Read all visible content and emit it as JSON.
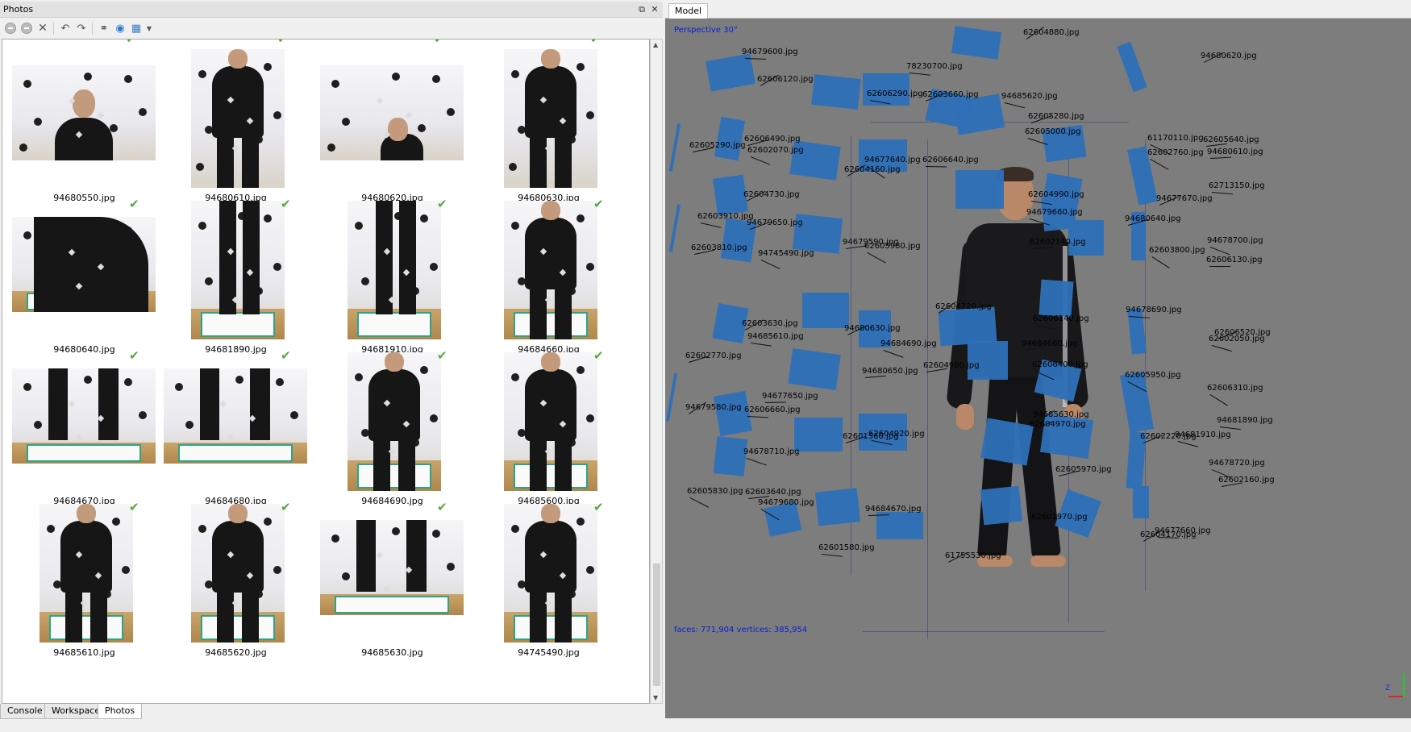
{
  "photos_panel": {
    "title": "Photos",
    "photos": [
      {
        "name": "94680550.jpg",
        "checked": false
      },
      {
        "name": "94680610.jpg",
        "checked": false
      },
      {
        "name": "94680620.jpg",
        "checked": false
      },
      {
        "name": "94680630.jpg",
        "checked": false
      },
      {
        "name": "94680640.jpg",
        "checked": true
      },
      {
        "name": "94681890.jpg",
        "checked": true
      },
      {
        "name": "94681910.jpg",
        "checked": true
      },
      {
        "name": "94684660.jpg",
        "checked": true
      },
      {
        "name": "94684670.jpg",
        "checked": true
      },
      {
        "name": "94684680.jpg",
        "checked": true
      },
      {
        "name": "94684690.jpg",
        "checked": true
      },
      {
        "name": "94685600.jpg",
        "checked": true
      },
      {
        "name": "94685610.jpg",
        "checked": true
      },
      {
        "name": "94685620.jpg",
        "checked": true
      },
      {
        "name": "94685630.jpg",
        "checked": true
      },
      {
        "name": "94745490.jpg",
        "checked": true
      }
    ],
    "check_glyph": "✔"
  },
  "bottom_tabs": {
    "console": "Console",
    "workspace": "Workspace",
    "photos": "Photos",
    "active": "Photos"
  },
  "model_panel": {
    "tab": "Model",
    "projection": "Perspective 30°",
    "stats": "faces: 771,904 vertices: 385,954",
    "axis_label": "Z",
    "camera_labels": [
      "62604880.jpg",
      "94679600.jpg",
      "62606120.jpg",
      "78230700.jpg",
      "94680620.jpg",
      "62606290.jpg",
      "62603660.jpg",
      "94685620.jpg",
      "62605280.jpg",
      "62605000.jpg",
      "62606490.jpg",
      "62602070.jpg",
      "62605290.jpg",
      "61170110.jpg",
      "62605640.jpg",
      "62602760.jpg",
      "94680610.jpg",
      "94677640.jpg",
      "62606640.jpg",
      "62604160.jpg",
      "62713150.jpg",
      "62604730.jpg",
      "62604990.jpg",
      "94677670.jpg",
      "62603910.jpg",
      "94679650.jpg",
      "94679660.jpg",
      "94680640.jpg",
      "94678700.jpg",
      "62603810.jpg",
      "94745490.jpg",
      "94679590.jpg",
      "62605980.jpg",
      "62602140.jpg",
      "62603800.jpg",
      "62606130.jpg",
      "62604720.jpg",
      "94678690.jpg",
      "62603630.jpg",
      "94685610.jpg",
      "94680630.jpg",
      "62606140.jpg",
      "62606520.jpg",
      "62602050.jpg",
      "62602770.jpg",
      "94684690.jpg",
      "94684660.jpg",
      "62606400.jpg",
      "62604980.jpg",
      "62605950.jpg",
      "94680650.jpg",
      "62606310.jpg",
      "94677650.jpg",
      "94679580.jpg",
      "62606660.jpg",
      "94685630.jpg",
      "94681890.jpg",
      "62604970.jpg",
      "62604920.jpg",
      "62602220.jpg",
      "94681910.jpg",
      "62601560.jpg",
      "94678710.jpg",
      "62605970.jpg",
      "94678720.jpg",
      "62602160.jpg",
      "62605830.jpg",
      "62603640.jpg",
      "94679680.jpg",
      "94684670.jpg",
      "62601970.jpg",
      "94677660.jpg",
      "62604170.jpg",
      "62601580.jpg",
      "61755530.jpg"
    ]
  }
}
